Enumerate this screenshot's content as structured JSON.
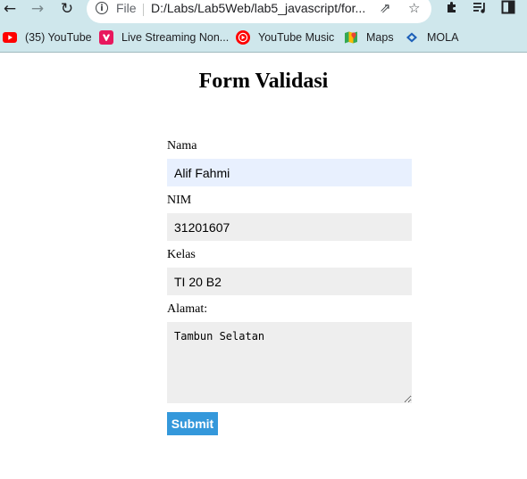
{
  "browser": {
    "omnibox": {
      "scheme_label": "File",
      "url": "D:/Labs/Lab5Web/lab5_javascript/for..."
    },
    "bookmarks": [
      {
        "label": "(35) YouTube",
        "icon": "youtube-icon"
      },
      {
        "label": "Live Streaming Non...",
        "icon": "vidio-icon"
      },
      {
        "label": "YouTube Music",
        "icon": "youtube-music-icon"
      },
      {
        "label": "Maps",
        "icon": "maps-icon"
      },
      {
        "label": "MOLA",
        "icon": "mola-icon"
      }
    ]
  },
  "page": {
    "title": "Form Validasi",
    "form": {
      "nama": {
        "label": "Nama",
        "value": "Alif Fahmi"
      },
      "nim": {
        "label": "NIM",
        "value": "31201607"
      },
      "kelas": {
        "label": "Kelas",
        "value": "TI 20 B2"
      },
      "alamat": {
        "label": "Alamat:",
        "value": "Tambun Selatan"
      },
      "submit_label": "Submit"
    }
  },
  "colors": {
    "chrome_bg": "#cfe7ec",
    "submit_bg": "#3498db",
    "input_bg": "#eeeeee",
    "autofill_bg": "#e8f0fe"
  }
}
